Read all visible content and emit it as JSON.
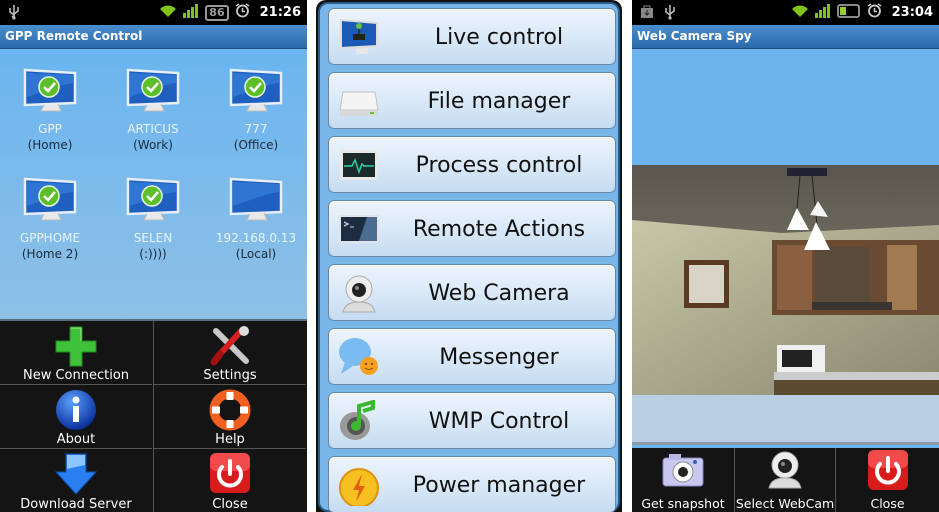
{
  "screen1": {
    "statusbar": {
      "icons": [
        "usb-icon",
        "wifi-icon",
        "signal-icon",
        "battery-icon",
        "alarm-icon"
      ],
      "battery": "86",
      "time": "21:26"
    },
    "title": "GPP Remote Control",
    "computers": [
      {
        "name": "GPP",
        "label": "(Home)",
        "online": true
      },
      {
        "name": "ARTICUS",
        "label": "(Work)",
        "online": true
      },
      {
        "name": "777",
        "label": "(Office)",
        "online": true
      },
      {
        "name": "GPPHOME",
        "label": "(Home 2)",
        "online": true
      },
      {
        "name": "SELEN",
        "label": "(:))))",
        "online": true
      },
      {
        "name": "192.168.0.13",
        "label": "(Local)",
        "online": false
      }
    ],
    "menu": [
      {
        "label": "New Connection",
        "icon": "plus-icon"
      },
      {
        "label": "Settings",
        "icon": "tools-icon"
      },
      {
        "label": "About",
        "icon": "info-icon"
      },
      {
        "label": "Help",
        "icon": "lifebuoy-icon"
      },
      {
        "label": "Download Server",
        "icon": "download-arrow-icon"
      },
      {
        "label": "Close",
        "icon": "power-icon"
      }
    ]
  },
  "screen2": {
    "buttons": [
      {
        "label": "Live control",
        "icon": "monitor-joystick-icon"
      },
      {
        "label": "File manager",
        "icon": "drive-icon"
      },
      {
        "label": "Process control",
        "icon": "heartbeat-monitor-icon"
      },
      {
        "label": "Remote Actions",
        "icon": "terminal-icon"
      },
      {
        "label": "Web Camera",
        "icon": "webcam-icon"
      },
      {
        "label": "Messenger",
        "icon": "chat-bubble-icon"
      },
      {
        "label": "WMP Control",
        "icon": "speaker-note-icon"
      },
      {
        "label": "Power manager",
        "icon": "lightning-icon"
      }
    ]
  },
  "screen3": {
    "statusbar": {
      "icons": [
        "download-bag-icon",
        "usb-icon",
        "wifi-icon",
        "signal-icon",
        "battery-icon",
        "alarm-icon"
      ],
      "time": "23:04"
    },
    "title": "Web Camera Spy",
    "buttons": [
      {
        "label": "Get snapshot",
        "icon": "camera-icon"
      },
      {
        "label": "Select WebCam",
        "icon": "webcam-icon"
      },
      {
        "label": "Close",
        "icon": "power-icon"
      }
    ]
  },
  "colors": {
    "accent": "#2c6aa8",
    "background": "#6db4ee",
    "menu_bg": "#141414"
  }
}
